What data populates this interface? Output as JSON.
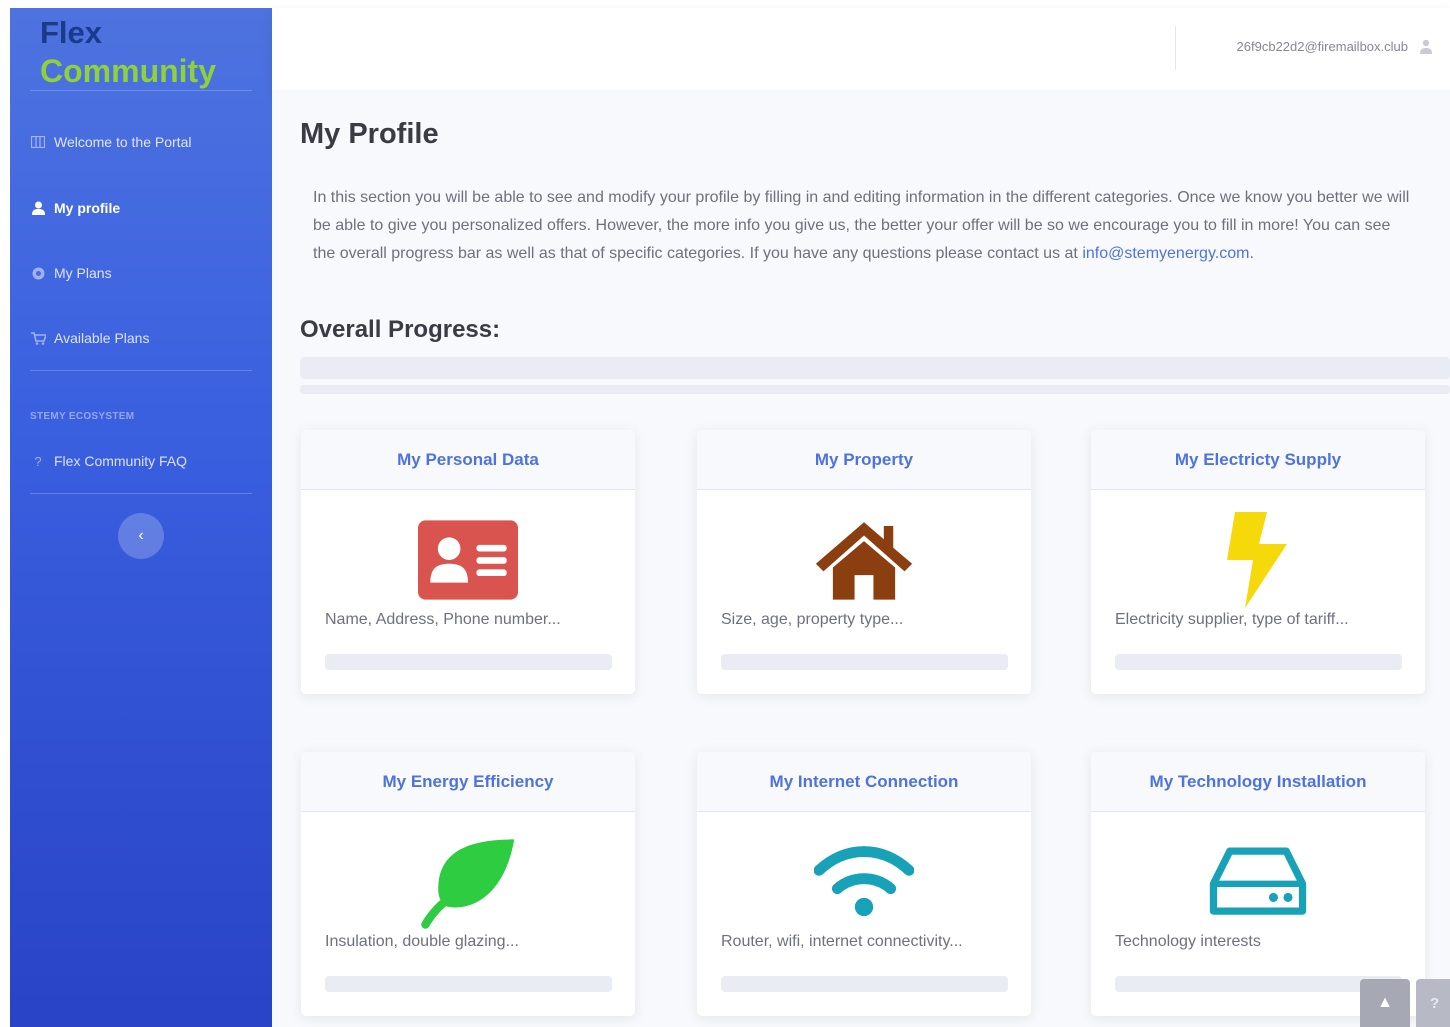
{
  "brand": {
    "line1": "Flex",
    "line2": "Community"
  },
  "sidebar": {
    "items": [
      {
        "label": "Welcome to the Portal",
        "icon": "columns-icon",
        "active": false
      },
      {
        "label": "My profile",
        "icon": "user-icon",
        "active": true
      },
      {
        "label": "My Plans",
        "icon": "circle-icon",
        "active": false
      },
      {
        "label": "Available Plans",
        "icon": "cart-icon",
        "active": false
      }
    ],
    "section_heading": "STEMY ECOSYSTEM",
    "faq": {
      "label": "Flex Community FAQ",
      "icon": "question-icon"
    },
    "toggle_glyph": "‹"
  },
  "topbar": {
    "email": "26f9cb22d2@firemailbox.club"
  },
  "page": {
    "title": "My Profile",
    "intro": "In this section you will be able to see and modify your profile by filling in and editing information in the different categories. Once we know you better we will be able to give you personalized offers. However, the more info you give us, the better your offer will be so we encourage you to fill in more! You can see the overall progress bar as well as that of specific categories. If you have any questions please contact us at ",
    "contact_email": "info@stemyenergy.com",
    "intro_end": ".",
    "overall_progress_label": "Overall Progress:",
    "overall_progress": 0
  },
  "cards": [
    {
      "title": "My Personal Data",
      "desc": "Name, Address, Phone number...",
      "icon": "id-card-icon",
      "color": "#d9534f",
      "progress": 0
    },
    {
      "title": "My Property",
      "desc": "Size, age, property type...",
      "icon": "house-icon",
      "color": "#8b3e0f",
      "progress": 0
    },
    {
      "title": "My Electricty Supply",
      "desc": "Electricity supplier, type of tariff...",
      "icon": "lightning-icon",
      "color": "#f5d90a",
      "progress": 0
    },
    {
      "title": "My Energy Efficiency",
      "desc": "Insulation, double glazing...",
      "icon": "leaf-icon",
      "color": "#2ecc40",
      "progress": 0
    },
    {
      "title": "My Internet Connection",
      "desc": "Router, wifi, internet connectivity...",
      "icon": "wifi-icon",
      "color": "#17a2b8",
      "progress": 0
    },
    {
      "title": "My Technology Installation",
      "desc": "Technology interests",
      "icon": "hdd-icon",
      "color": "#17a2b8",
      "progress": 0
    }
  ],
  "floating": {
    "scroll_top_glyph": "▲",
    "help_glyph": "?"
  },
  "colors": {
    "primary": "#4e73df",
    "accent_green": "#8fd13a",
    "background": "#f8f9fc"
  }
}
